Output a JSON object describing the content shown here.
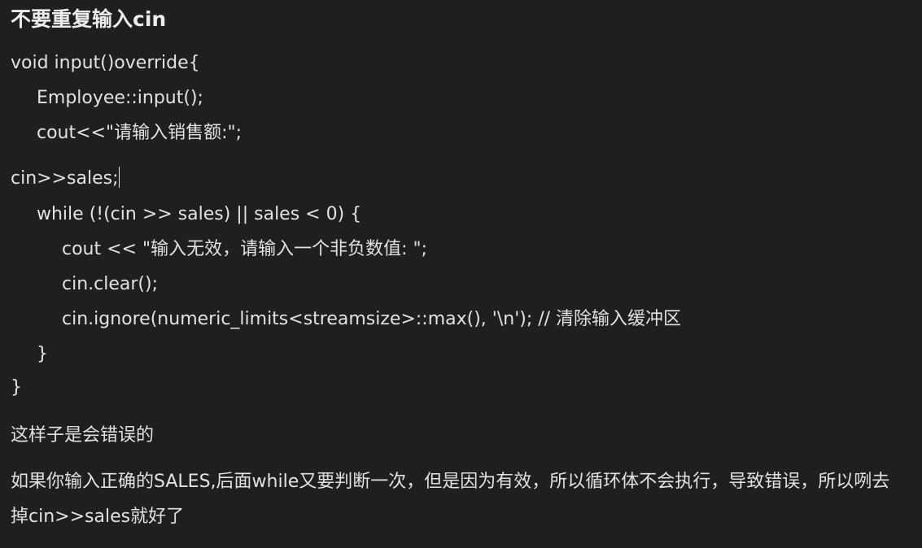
{
  "heading": "不要重复输入cin",
  "code": {
    "line1": "void input()override{",
    "line2": "Employee::input();",
    "line3": "cout<<\"请输入销售额:\";",
    "line4": "cin>>sales;",
    "line5": "while (!(cin >> sales) || sales < 0) {",
    "line6": "cout << \"输入无效，请输入一个非负数值: \";",
    "line7": "cin.clear();",
    "line8": "cin.ignore(numeric_limits<streamsize>::max(), '\\n'); // 清除输入缓冲区",
    "line9": "}",
    "line10": "}"
  },
  "paragraphs": {
    "p1": "这样子是会错误的",
    "p2": "如果你输入正确的SALES,后面while又要判断一次，但是因为有效，所以循环体不会执行，导致错误，所以咧去掉cin>>sales就好了"
  }
}
